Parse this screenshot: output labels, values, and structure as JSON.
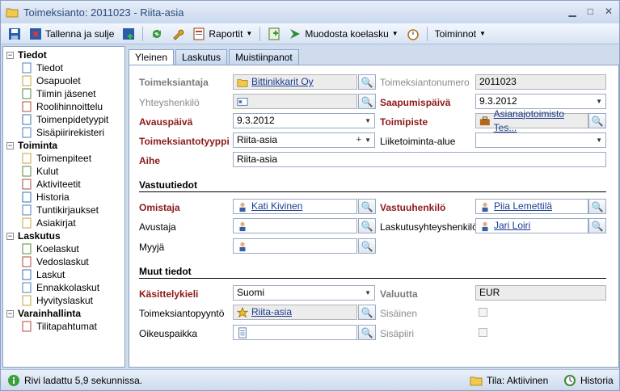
{
  "window": {
    "title": "Toimeksianto: 2011023 - Riita-asia"
  },
  "toolbar": {
    "save_close": "Tallenna ja sulje",
    "reports": "Raportit",
    "make_invoice": "Muodosta koelasku",
    "actions": "Toiminnot"
  },
  "sidebar": {
    "groups": [
      {
        "label": "Tiedot",
        "items": [
          "Tiedot",
          "Osapuolet",
          "Tiimin jäsenet",
          "Roolihinnoittelu",
          "Toimenpidetyypit",
          "Sisäpiirirekisteri"
        ]
      },
      {
        "label": "Toiminta",
        "items": [
          "Toimenpiteet",
          "Kulut",
          "Aktiviteetit",
          "Historia",
          "Tuntikirjaukset",
          "Asiakirjat"
        ]
      },
      {
        "label": "Laskutus",
        "items": [
          "Koelaskut",
          "Vedoslaskut",
          "Laskut",
          "Ennakkolaskut",
          "Hyvityslaskut"
        ]
      },
      {
        "label": "Varainhallinta",
        "items": [
          "Tilitapahtumat"
        ]
      }
    ]
  },
  "tabs": [
    "Yleinen",
    "Laskutus",
    "Muistiinpanot"
  ],
  "form": {
    "client_label": "Toimeksiantaja",
    "client_value": "Bittinikkarit Oy",
    "number_label": "Toimeksiantonumero",
    "number_value": "2011023",
    "contact_label": "Yhteyshenkilö",
    "received_label": "Saapumispäivä",
    "received_value": "9.3.2012",
    "opened_label": "Avauspäivä",
    "opened_value": "9.3.2012",
    "office_label": "Toimipiste",
    "office_value": "Asianajotoimisto Tes...",
    "type_label": "Toimeksiantotyyppi",
    "type_value": "Riita-asia",
    "area_label": "Liiketoiminta-alue",
    "subject_label": "Aihe",
    "subject_value": "Riita-asia",
    "resp_section": "Vastuutiedot",
    "owner_label": "Omistaja",
    "owner_value": "Kati Kivinen",
    "responsible_label": "Vastuuhenkilö",
    "responsible_value": "Piia Lemettilä",
    "assistant_label": "Avustaja",
    "billing_contact_label": "Laskutusyhteyshenkilö",
    "billing_contact_value": "Jari Loiri",
    "seller_label": "Myyjä",
    "other_section": "Muut tiedot",
    "language_label": "Käsittelykieli",
    "language_value": "Suomi",
    "currency_label": "Valuutta",
    "currency_value": "EUR",
    "request_label": "Toimeksiantopyyntö",
    "request_value": "Riita-asia",
    "internal_label": "Sisäinen",
    "court_label": "Oikeuspaikka",
    "insider_label": "Sisäpiiri"
  },
  "status": {
    "loaded": "Rivi ladattu 5,9 sekunnissa.",
    "state": "Tila: Aktiivinen",
    "history": "Historia"
  }
}
